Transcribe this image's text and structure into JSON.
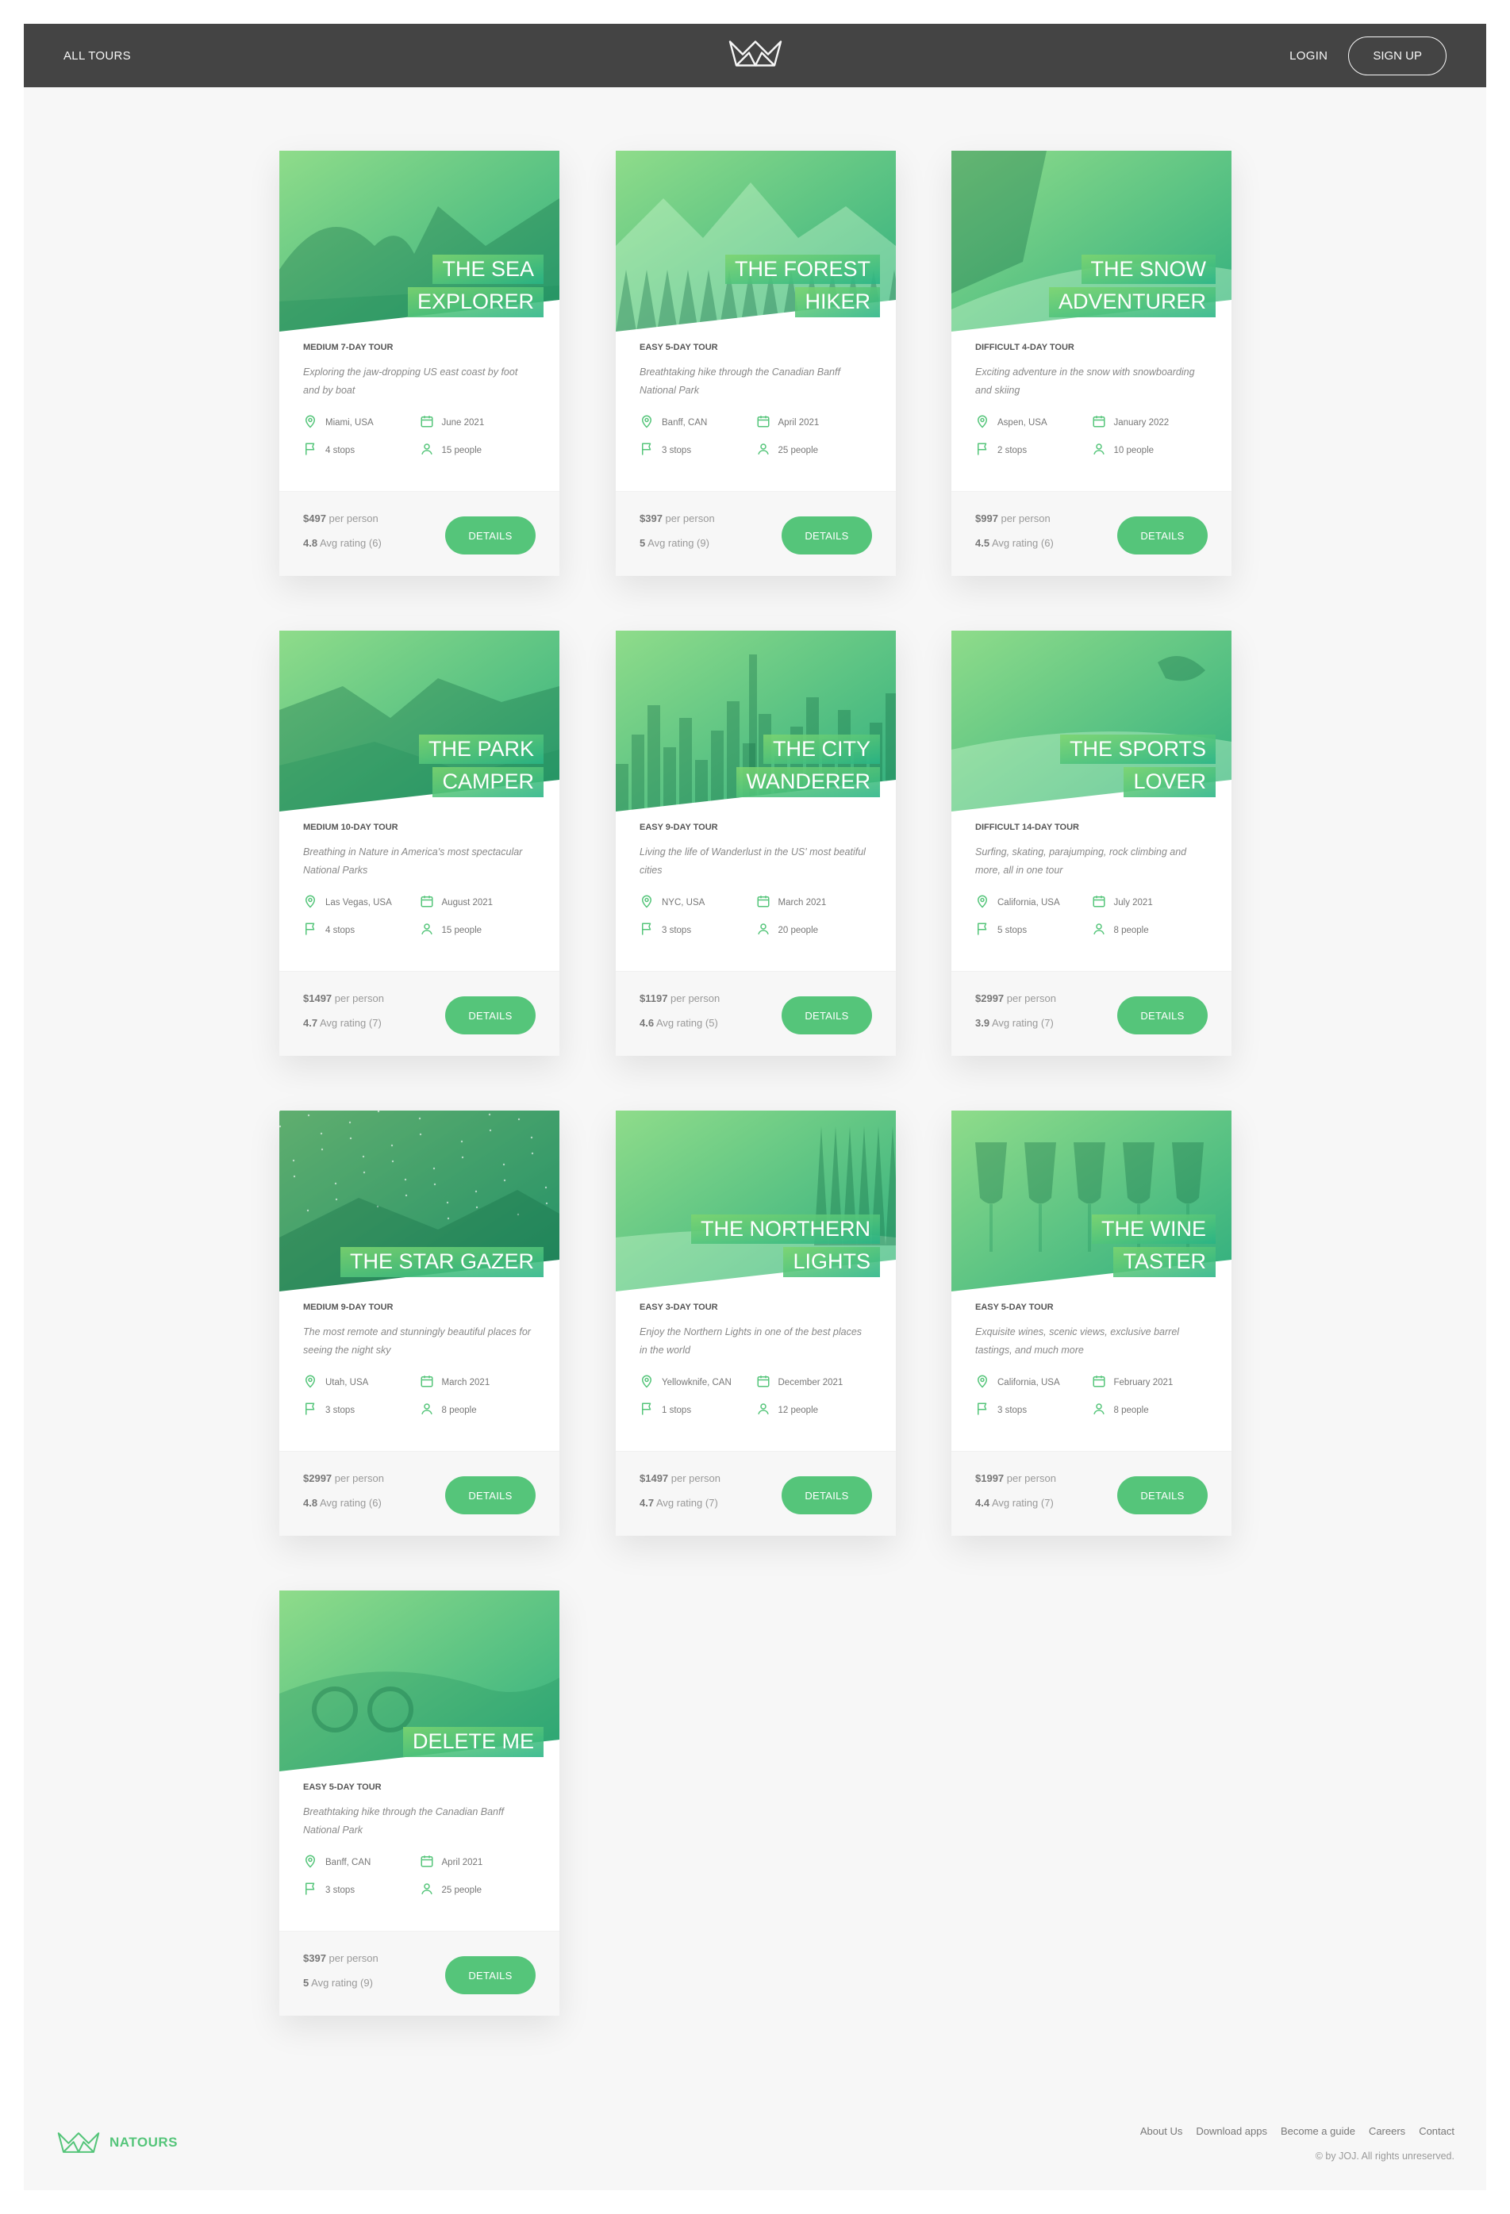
{
  "header": {
    "all_tours": "ALL TOURS",
    "login": "LOGIN",
    "signup": "SIGN UP",
    "logo_icon": "natours-crown-logo"
  },
  "colors": {
    "accent": "#55c57a",
    "header_bg": "#444444",
    "page_bg": "#f7f7f7"
  },
  "tours": [
    {
      "title_lines": [
        "THE SEA",
        "EXPLORER"
      ],
      "sub": "MEDIUM 7-DAY TOUR",
      "desc": "Exploring the jaw-dropping US east coast by foot and by boat",
      "location": "Miami, USA",
      "date": "June 2021",
      "stops": "4 stops",
      "people": "15 people",
      "price": "$497",
      "price_suffix": " per person",
      "rating": "4.8",
      "rating_suffix": " Avg rating (6)",
      "btn": "DETAILS",
      "scene": "sea"
    },
    {
      "title_lines": [
        "THE FOREST",
        "HIKER"
      ],
      "sub": "EASY 5-DAY TOUR",
      "desc": "Breathtaking hike through the Canadian Banff National Park",
      "location": "Banff, CAN",
      "date": "April 2021",
      "stops": "3 stops",
      "people": "25 people",
      "price": "$397",
      "price_suffix": " per person",
      "rating": "5",
      "rating_suffix": " Avg rating (9)",
      "btn": "DETAILS",
      "scene": "forest"
    },
    {
      "title_lines": [
        "THE SNOW",
        "ADVENTURER"
      ],
      "sub": "DIFFICULT 4-DAY TOUR",
      "desc": "Exciting adventure in the snow with snowboarding and skiing",
      "location": "Aspen, USA",
      "date": "January 2022",
      "stops": "2 stops",
      "people": "10 people",
      "price": "$997",
      "price_suffix": " per person",
      "rating": "4.5",
      "rating_suffix": " Avg rating (6)",
      "btn": "DETAILS",
      "scene": "snow"
    },
    {
      "title_lines": [
        "THE PARK",
        "CAMPER"
      ],
      "sub": "MEDIUM 10-DAY TOUR",
      "desc": "Breathing in Nature in America's most spectacular National Parks",
      "location": "Las Vegas, USA",
      "date": "August 2021",
      "stops": "4 stops",
      "people": "15 people",
      "price": "$1497",
      "price_suffix": " per person",
      "rating": "4.7",
      "rating_suffix": " Avg rating (7)",
      "btn": "DETAILS",
      "scene": "park"
    },
    {
      "title_lines": [
        "THE CITY",
        "WANDERER"
      ],
      "sub": "EASY 9-DAY TOUR",
      "desc": "Living the life of Wanderlust in the US' most beatiful cities",
      "location": "NYC, USA",
      "date": "March 2021",
      "stops": "3 stops",
      "people": "20 people",
      "price": "$1197",
      "price_suffix": " per person",
      "rating": "4.6",
      "rating_suffix": " Avg rating (5)",
      "btn": "DETAILS",
      "scene": "city"
    },
    {
      "title_lines": [
        "THE SPORTS",
        "LOVER"
      ],
      "sub": "DIFFICULT 14-DAY TOUR",
      "desc": "Surfing, skating, parajumping, rock climbing and more, all in one tour",
      "location": "California, USA",
      "date": "July 2021",
      "stops": "5 stops",
      "people": "8 people",
      "price": "$2997",
      "price_suffix": " per person",
      "rating": "3.9",
      "rating_suffix": " Avg rating (7)",
      "btn": "DETAILS",
      "scene": "sports"
    },
    {
      "title_lines": [
        "THE STAR GAZER"
      ],
      "sub": "MEDIUM 9-DAY TOUR",
      "desc": "The most remote and stunningly beautiful places for seeing the night sky",
      "location": "Utah, USA",
      "date": "March 2021",
      "stops": "3 stops",
      "people": "8 people",
      "price": "$2997",
      "price_suffix": " per person",
      "rating": "4.8",
      "rating_suffix": " Avg rating (6)",
      "btn": "DETAILS",
      "scene": "stars"
    },
    {
      "title_lines": [
        "THE NORTHERN",
        "LIGHTS"
      ],
      "sub": "EASY 3-DAY TOUR",
      "desc": "Enjoy the Northern Lights in one of the best places in the world",
      "location": "Yellowknife, CAN",
      "date": "December 2021",
      "stops": "1 stops",
      "people": "12 people",
      "price": "$1497",
      "price_suffix": " per person",
      "rating": "4.7",
      "rating_suffix": " Avg rating (7)",
      "btn": "DETAILS",
      "scene": "northern"
    },
    {
      "title_lines": [
        "THE WINE",
        "TASTER"
      ],
      "sub": "EASY 5-DAY TOUR",
      "desc": "Exquisite wines, scenic views, exclusive barrel tastings, and much more",
      "location": "California, USA",
      "date": "February 2021",
      "stops": "3 stops",
      "people": "8 people",
      "price": "$1997",
      "price_suffix": " per person",
      "rating": "4.4",
      "rating_suffix": " Avg rating (7)",
      "btn": "DETAILS",
      "scene": "wine"
    },
    {
      "title_lines": [
        "DELETE ME"
      ],
      "sub": "EASY 5-DAY TOUR",
      "desc": "Breathtaking hike through the Canadian Banff National Park",
      "location": "Banff, CAN",
      "date": "April 2021",
      "stops": "3 stops",
      "people": "25 people",
      "price": "$397",
      "price_suffix": " per person",
      "rating": "5",
      "rating_suffix": " Avg rating (9)",
      "btn": "DETAILS",
      "scene": "bike"
    }
  ],
  "footer": {
    "brand": "NATOURS",
    "links": [
      "About Us",
      "Download apps",
      "Become a guide",
      "Careers",
      "Contact"
    ],
    "copyright": "© by JOJ. All rights unreserved."
  }
}
